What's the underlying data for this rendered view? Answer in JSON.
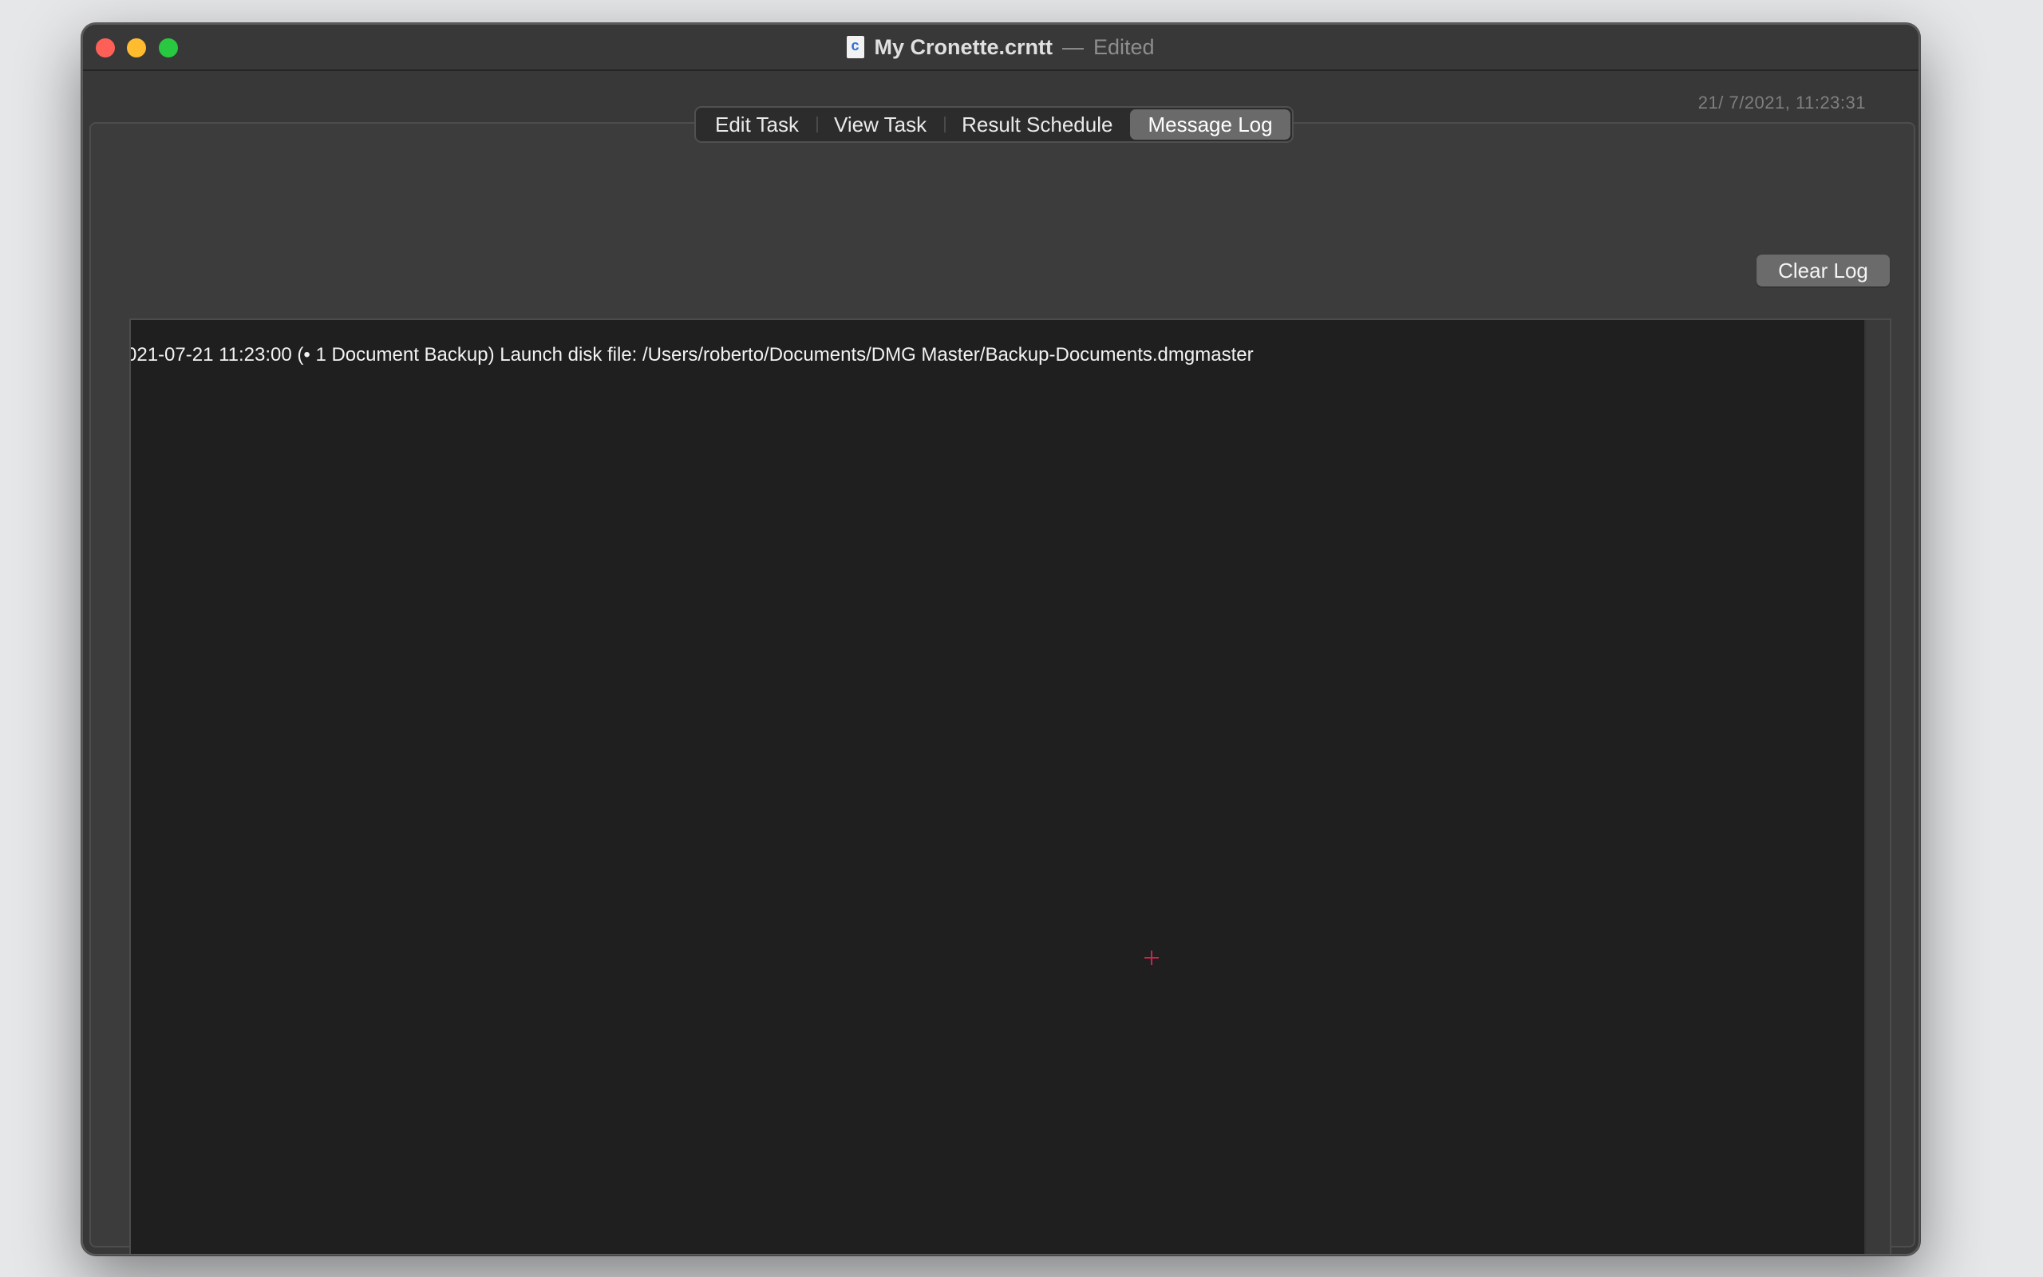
{
  "window": {
    "title": "My Cronette.crntt",
    "separator": "—",
    "status": "Edited",
    "doc_icon": "cronette-document-icon"
  },
  "timestamp": "21/  7/2021, 11:23:31",
  "tabs": [
    {
      "label": "Edit Task",
      "selected": false
    },
    {
      "label": "View Task",
      "selected": false
    },
    {
      "label": "Result Schedule",
      "selected": false
    },
    {
      "label": "Message Log",
      "selected": true
    }
  ],
  "toolbar": {
    "clear_log_label": "Clear Log"
  },
  "log": {
    "lines": [
      "021-07-21 11:23:00  (• 1 Document Backup) Launch disk file: /Users/roberto/Documents/DMG Master/Backup-Documents.dmgmaster"
    ]
  },
  "colors": {
    "close": "#fe5f57",
    "minimize": "#febc2e",
    "zoom": "#28c840",
    "cursor": "#d0214a"
  }
}
